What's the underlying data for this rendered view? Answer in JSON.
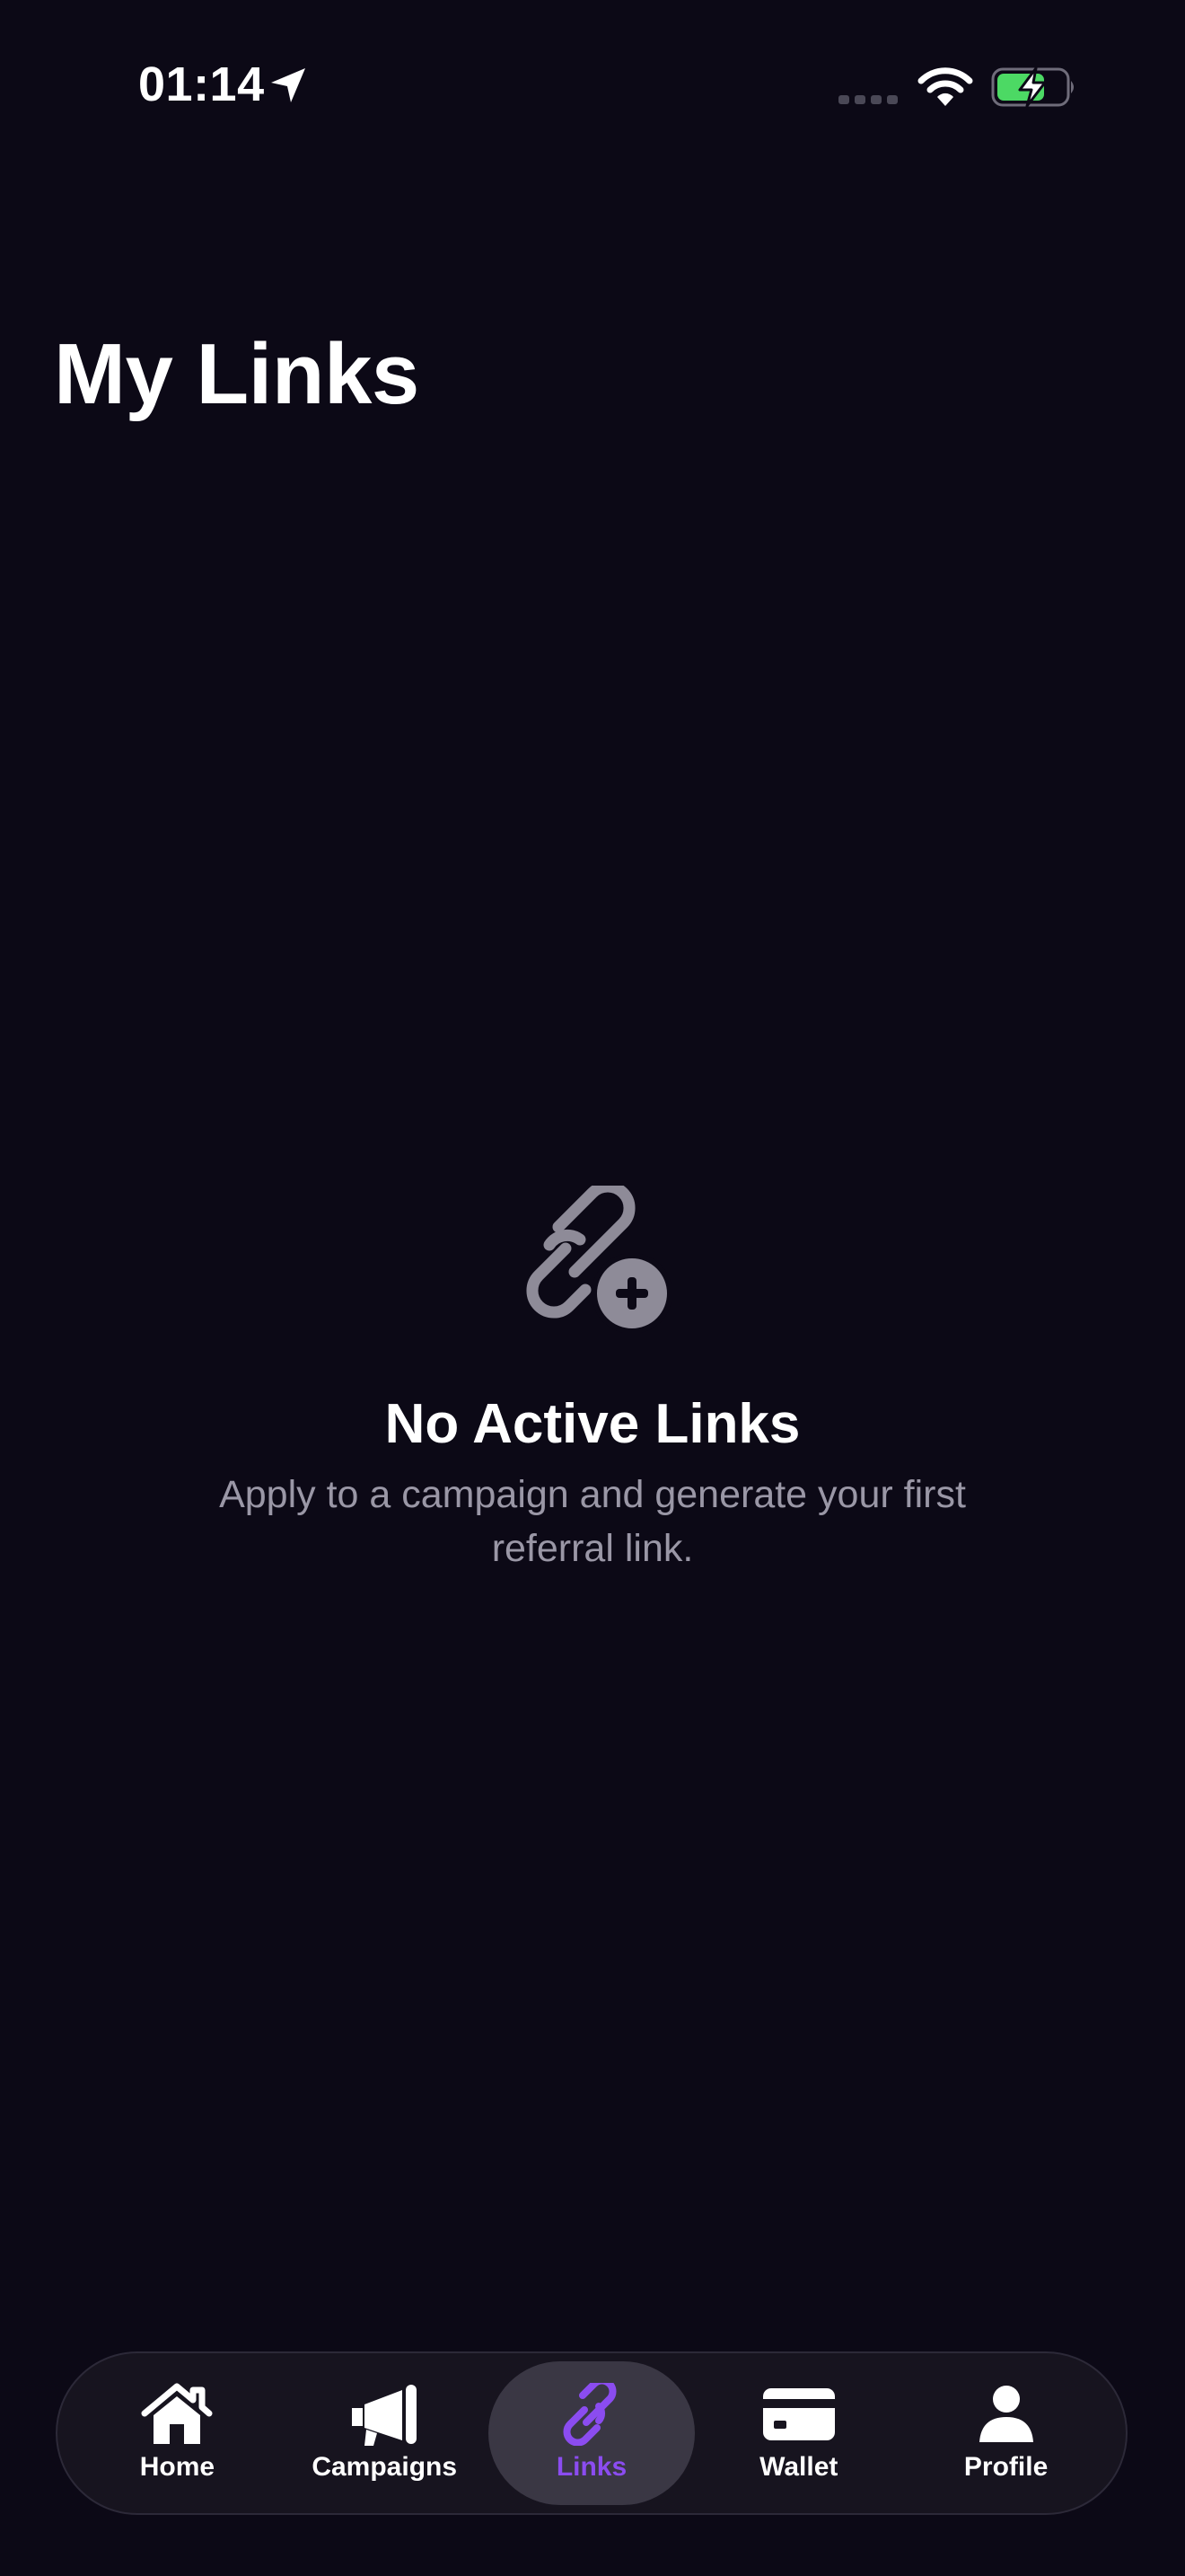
{
  "status_bar": {
    "time": "01:14",
    "icons": [
      "location-arrow-icon",
      "cellular-signal-icon",
      "wifi-icon",
      "battery-charging-icon"
    ],
    "battery_color": "#4cd964"
  },
  "page": {
    "title": "My Links"
  },
  "empty_state": {
    "icon": "link-plus-icon",
    "title": "No Active Links",
    "subtitle": "Apply to a campaign and generate your first referral link."
  },
  "tab_bar": {
    "active_color": "#8b4cf0",
    "items": [
      {
        "label": "Home",
        "icon": "home-icon",
        "active": false
      },
      {
        "label": "Campaigns",
        "icon": "megaphone-icon",
        "active": false
      },
      {
        "label": "Links",
        "icon": "link-icon",
        "active": true
      },
      {
        "label": "Wallet",
        "icon": "credit-card-icon",
        "active": false
      },
      {
        "label": "Profile",
        "icon": "person-icon",
        "active": false
      }
    ]
  }
}
